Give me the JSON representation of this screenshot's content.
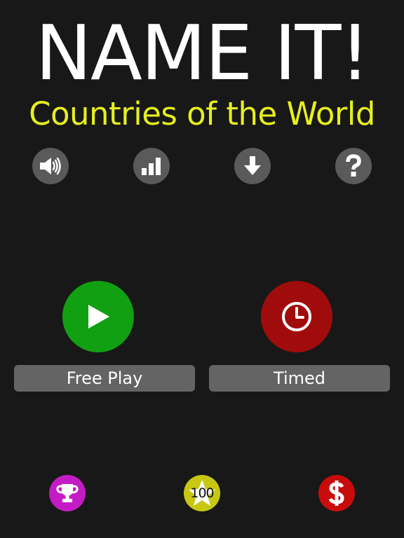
{
  "header": {
    "title": "NAME IT!",
    "subtitle": "Countries of the World"
  },
  "toolbar": {
    "icons": [
      "speaker-icon",
      "stats-icon",
      "download-icon",
      "help-icon"
    ]
  },
  "modes": {
    "free_play_label": "Free Play",
    "timed_label": "Timed"
  },
  "bottom_bar": {
    "challenge_label": "100"
  },
  "colors": {
    "background": "#181818",
    "title": "#ffffff",
    "subtitle": "#e6f01e",
    "icon_circle": "#5a5a5a",
    "free_play": "#11a011",
    "timed": "#a00c0c",
    "label_bar": "#646464",
    "trophy": "#c41cc4",
    "hundred": "#c8c814",
    "dollar": "#c80c0c"
  }
}
